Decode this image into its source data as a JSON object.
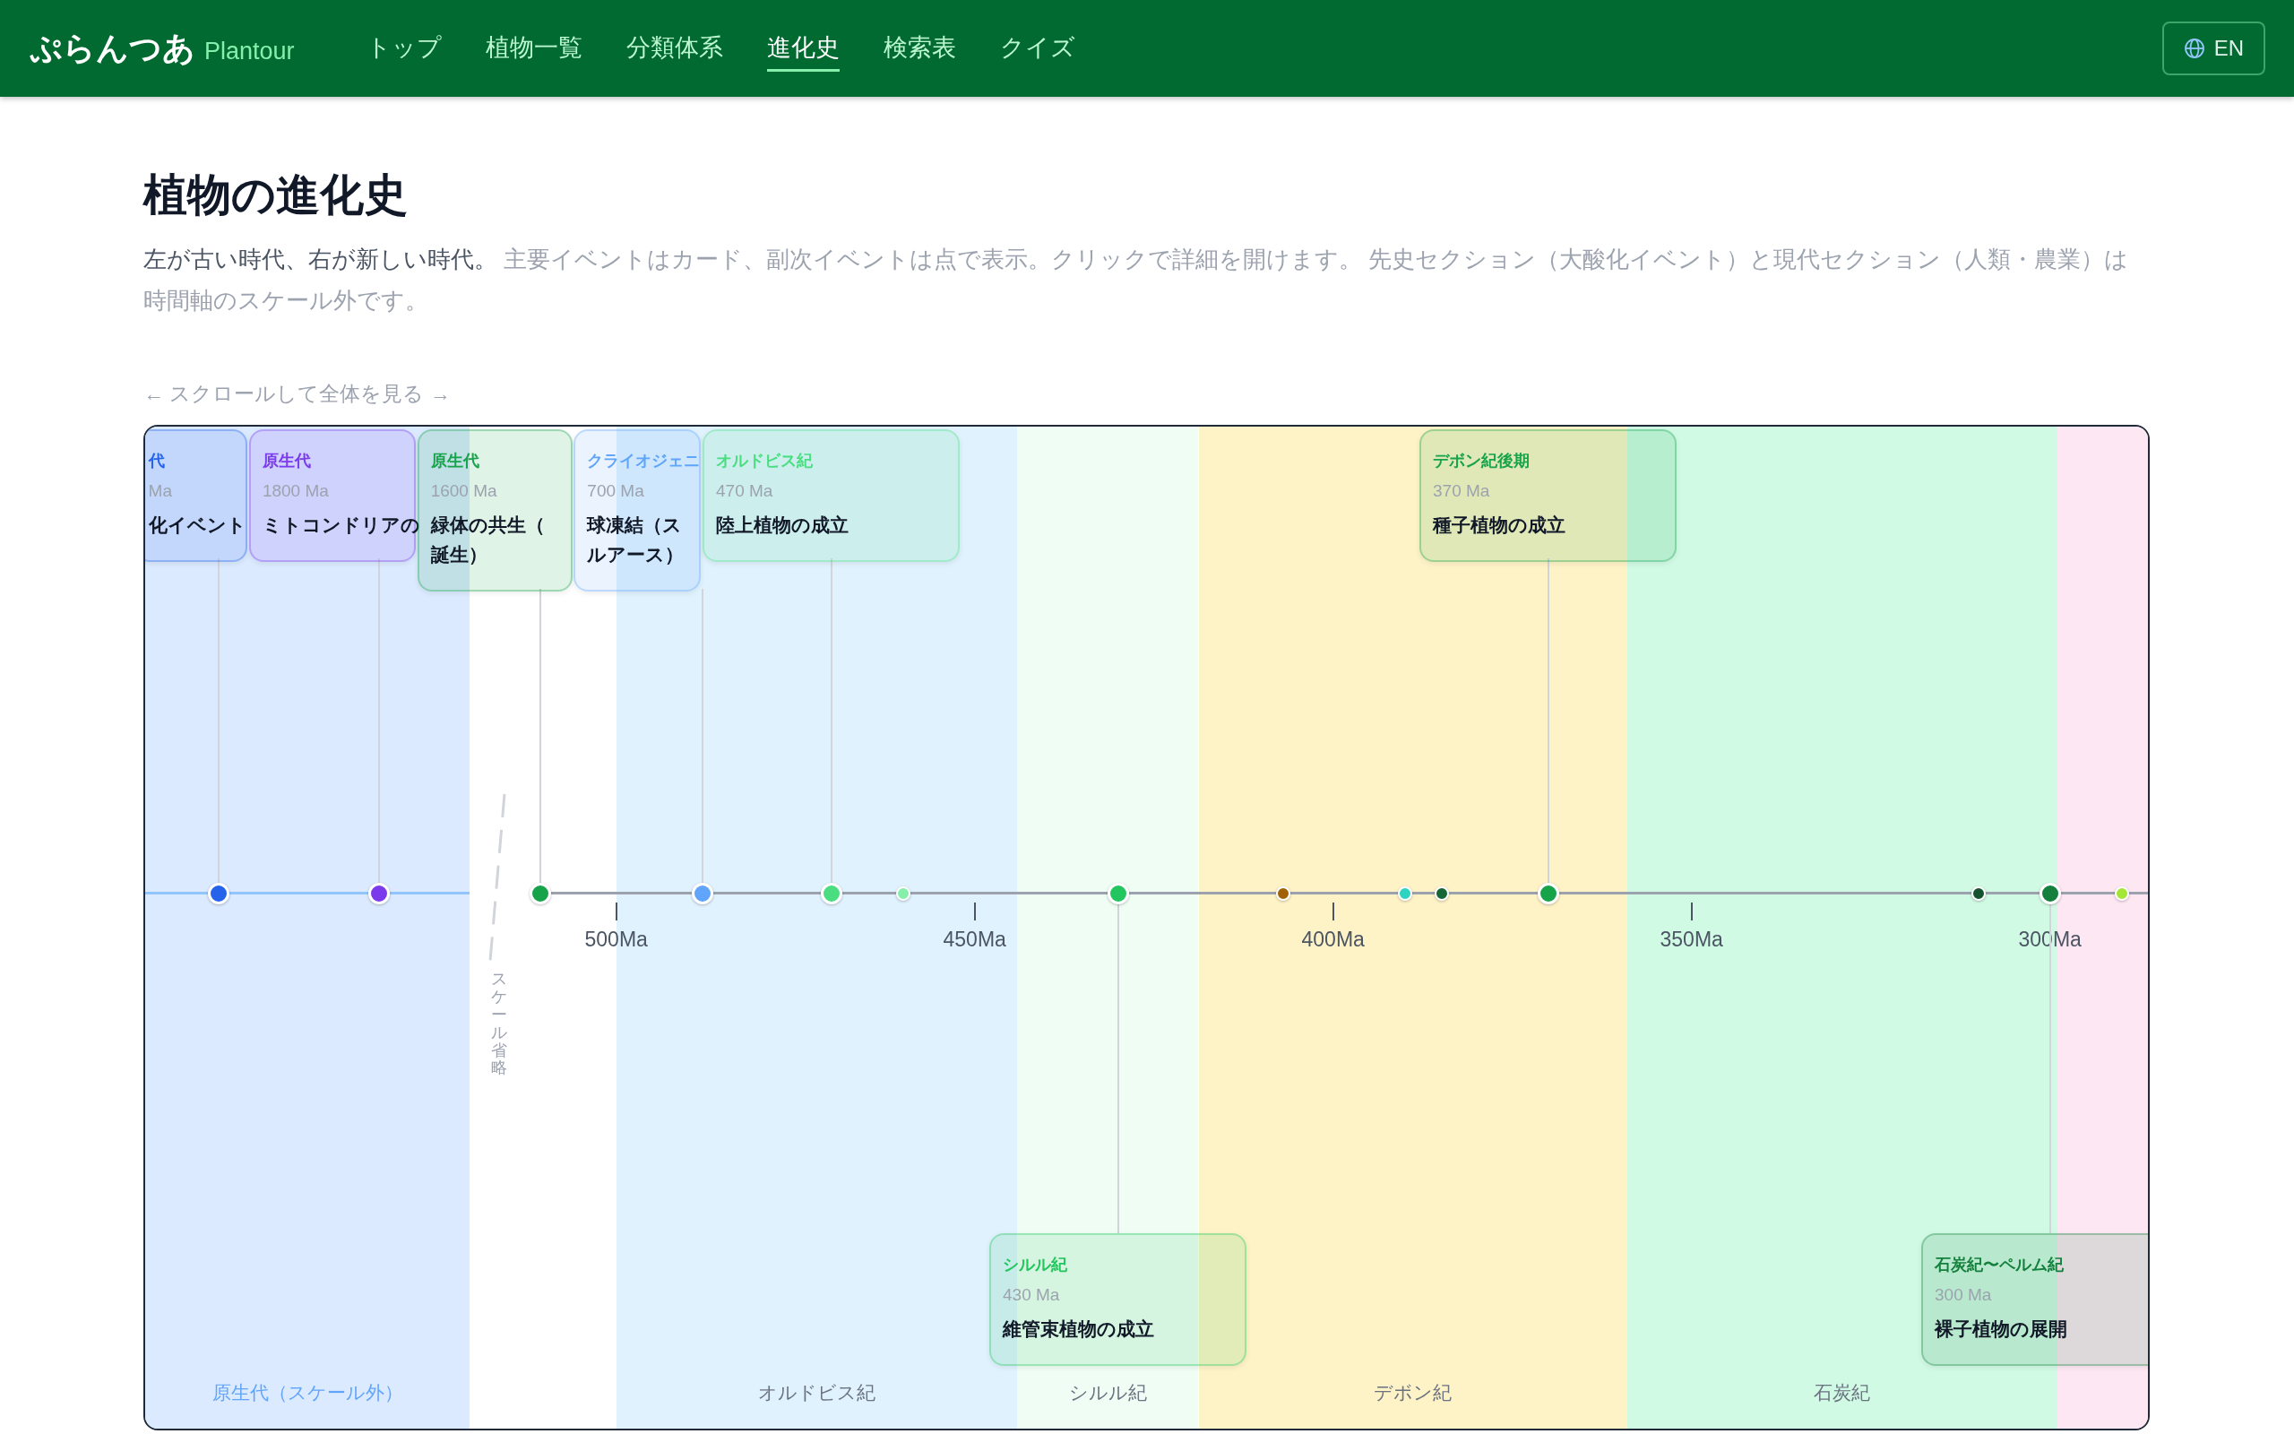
{
  "header": {
    "logo": "ぷらんつあ",
    "logo_sub": "Plantour",
    "nav": [
      {
        "label": "トップ",
        "selected": false
      },
      {
        "label": "植物一覧",
        "selected": false
      },
      {
        "label": "分類体系",
        "selected": false
      },
      {
        "label": "進化史",
        "selected": true
      },
      {
        "label": "検索表",
        "selected": false
      },
      {
        "label": "クイズ",
        "selected": false
      }
    ],
    "language_button": "EN"
  },
  "page": {
    "title": "植物の進化史",
    "description": {
      "lead": "左が古い時代、右が新しい時代。",
      "note": "主要イベントはカード、副次イベントは点で表示。クリックで詳細を開けます。 先史セクション（大酸化イベント）と現代セクション（人類・農業）は時間軸のスケール外です。"
    },
    "scroll_hint": "← スクロールして全体を見る →"
  },
  "timeline": {
    "eras": [
      {
        "kind": "offscale",
        "label": "原生代（スケール外）",
        "color": "#dbeafe"
      },
      {
        "kind": "period",
        "label": "オルドビス紀",
        "color": "#e0f2fe"
      },
      {
        "kind": "period",
        "label": "シルル紀",
        "color": "#f0fdf4"
      },
      {
        "kind": "period",
        "label": "デボン紀",
        "color": "#fef3c7"
      },
      {
        "kind": "period",
        "label": "石炭紀",
        "color": "#d1fae5"
      },
      {
        "kind": "period",
        "color": "#fce7f3"
      }
    ],
    "scale_gap_label": "スケール省略",
    "ticks": [
      "500Ma",
      "450Ma",
      "400Ma",
      "350Ma",
      "300Ma"
    ],
    "events": [
      {
        "kind": "above",
        "color": "#2563eb",
        "era": "代",
        "age": "Ma",
        "title_lines": [
          "化イベント"
        ]
      },
      {
        "kind": "above",
        "color": "#7c3aed",
        "era": "原生代",
        "age": "1800 Ma",
        "title_lines": [
          "ミトコンドリアの"
        ]
      },
      {
        "kind": "above",
        "color": "#16a34a",
        "era": "原生代",
        "age": "1600 Ma",
        "title_lines": [
          "緑体の共生（",
          "誕生）"
        ]
      },
      {
        "kind": "above",
        "color": "#60a5fa",
        "era": "クライオジェニ",
        "age": "700 Ma",
        "title_lines": [
          "球凍結（ス",
          "ルアース）"
        ]
      },
      {
        "kind": "above",
        "color": "#4ade80",
        "era": "オルドビス紀",
        "age": "470 Ma",
        "title_lines": [
          "陸上植物の成立"
        ]
      },
      {
        "kind": "dot",
        "color": "#86efac"
      },
      {
        "kind": "below",
        "color": "#22c55e",
        "era": "シルル紀",
        "age": "430 Ma",
        "title_lines": [
          "維管束植物の成立"
        ]
      },
      {
        "kind": "dot",
        "color": "#a16207"
      },
      {
        "kind": "dot",
        "color": "#2dd4bf"
      },
      {
        "kind": "dot",
        "color": "#166534"
      },
      {
        "kind": "above",
        "color": "#16a34a",
        "era": "デボン紀後期",
        "age": "370 Ma",
        "title_lines": [
          "種子植物の成立"
        ]
      },
      {
        "kind": "dot",
        "color": "#14532d"
      },
      {
        "kind": "below",
        "color": "#15803d",
        "era": "石炭紀〜ペルム紀",
        "age": "300 Ma",
        "title_lines": [
          "裸子植物の展開"
        ]
      },
      {
        "kind": "dot",
        "color": "#a3e635"
      }
    ]
  }
}
